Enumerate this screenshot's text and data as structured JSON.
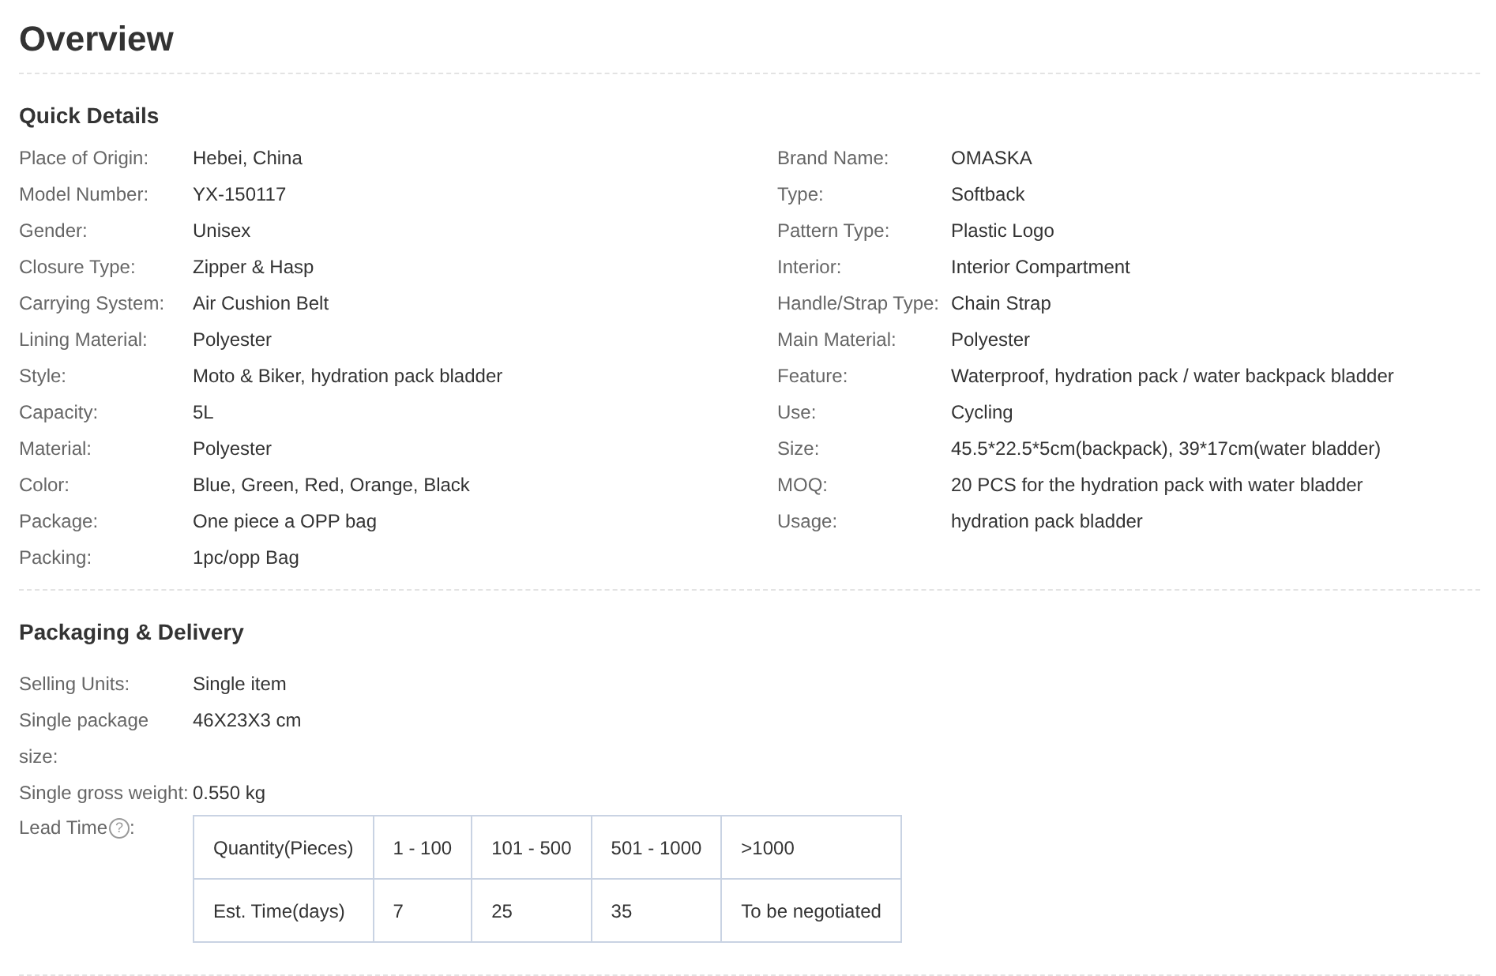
{
  "title": "Overview",
  "quick_details": {
    "heading": "Quick Details",
    "left": [
      {
        "label": "Place of Origin:",
        "value": "Hebei, China"
      },
      {
        "label": "Model Number:",
        "value": "YX-150117"
      },
      {
        "label": "Gender:",
        "value": "Unisex"
      },
      {
        "label": "Closure Type:",
        "value": "Zipper & Hasp"
      },
      {
        "label": "Carrying System:",
        "value": "Air Cushion Belt"
      },
      {
        "label": "Lining Material:",
        "value": "Polyester"
      },
      {
        "label": "Style:",
        "value": "Moto & Biker, hydration pack bladder"
      },
      {
        "label": "Capacity:",
        "value": "5L"
      },
      {
        "label": "Material:",
        "value": "Polyester"
      },
      {
        "label": "Color:",
        "value": "Blue, Green, Red, Orange, Black"
      },
      {
        "label": "Package:",
        "value": "One piece a OPP bag"
      },
      {
        "label": "Packing:",
        "value": "1pc/opp Bag"
      }
    ],
    "right": [
      {
        "label": "Brand Name:",
        "value": "OMASKA"
      },
      {
        "label": "Type:",
        "value": "Softback"
      },
      {
        "label": "Pattern Type:",
        "value": "Plastic Logo"
      },
      {
        "label": "Interior:",
        "value": "Interior Compartment"
      },
      {
        "label": "Handle/Strap Type:",
        "value": "Chain Strap"
      },
      {
        "label": "Main Material:",
        "value": "Polyester"
      },
      {
        "label": "Feature:",
        "value": "Waterproof, hydration pack / water backpack bladder"
      },
      {
        "label": "Use:",
        "value": "Cycling"
      },
      {
        "label": "Size:",
        "value": "45.5*22.5*5cm(backpack), 39*17cm(water bladder)"
      },
      {
        "label": "MOQ:",
        "value": "20 PCS for the hydration pack with water bladder"
      },
      {
        "label": "Usage:",
        "value": "hydration pack bladder"
      }
    ]
  },
  "packaging": {
    "heading": "Packaging & Delivery",
    "rows": [
      {
        "label": "Selling Units:",
        "value": "Single item"
      },
      {
        "label": "Single package size:",
        "value": "46X23X3 cm"
      },
      {
        "label": "Single gross weight:",
        "value": "0.550 kg"
      }
    ],
    "lead_time": {
      "label": "Lead Time",
      "help": "?",
      "suffix": ":",
      "table": [
        [
          "Quantity(Pieces)",
          "1 - 100",
          "101 - 500",
          "501 - 1000",
          ">1000"
        ],
        [
          "Est. Time(days)",
          "7",
          "25",
          "35",
          "To be negotiated"
        ]
      ]
    }
  }
}
